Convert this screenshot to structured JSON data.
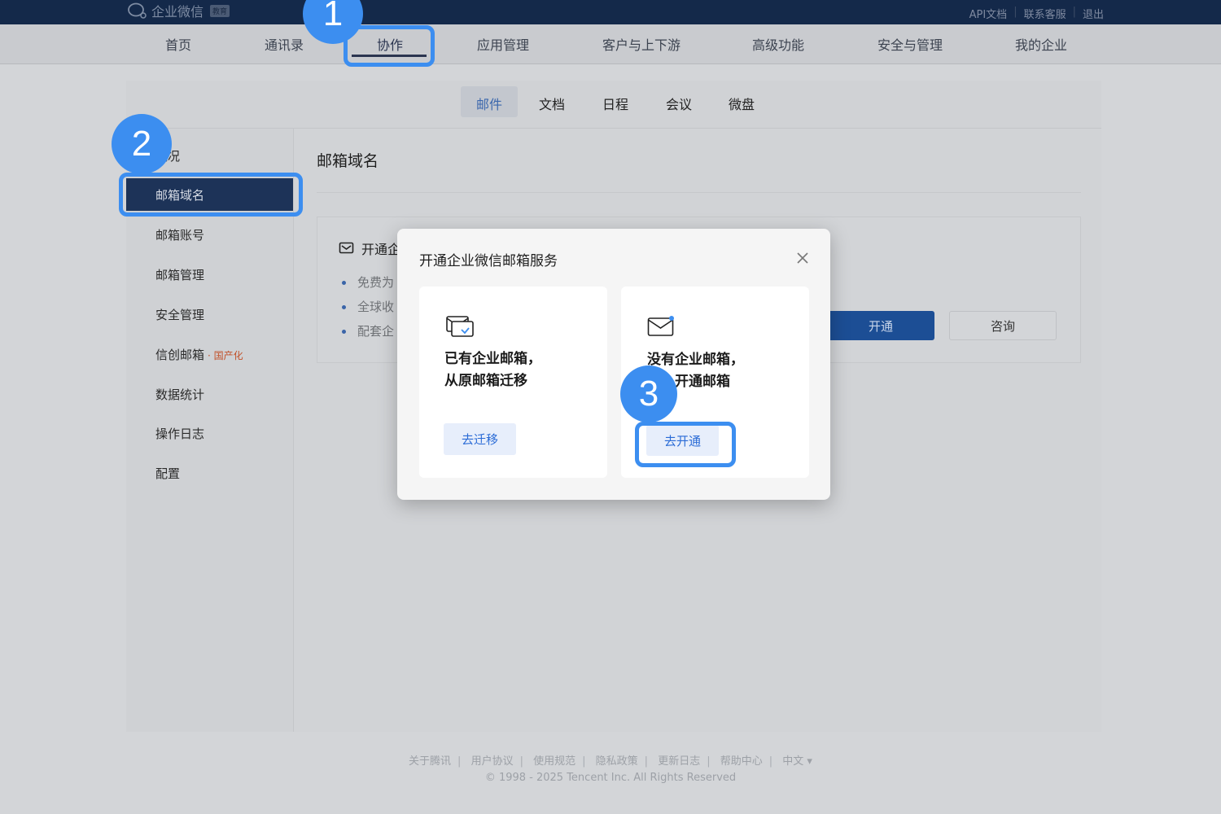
{
  "header": {
    "logo_text": "企业微信",
    "logo_badge": "教育",
    "links": [
      "API文档",
      "联系客服",
      "退出"
    ]
  },
  "nav": {
    "items": [
      "首页",
      "通讯录",
      "协作",
      "应用管理",
      "客户与上下游",
      "高级功能",
      "安全与管理",
      "我的企业"
    ],
    "active": "协作"
  },
  "subtabs": {
    "items": [
      "邮件",
      "文档",
      "日程",
      "会议",
      "微盘"
    ],
    "active": "邮件"
  },
  "sidebar": {
    "items": [
      "概况",
      "邮箱域名",
      "邮箱账号",
      "邮箱管理",
      "安全管理",
      "信创邮箱",
      "数据统计",
      "操作日志",
      "配置"
    ],
    "active": "邮箱域名",
    "xinchuang_tag": "· 国产化"
  },
  "main": {
    "title": "邮箱域名",
    "card_title": "开通企",
    "bullets": [
      "免费为",
      "全球收",
      "配套企"
    ],
    "open_button": "开通",
    "consult_button": "咨询"
  },
  "modal": {
    "title": "开通企业微信邮箱服务",
    "options": [
      {
        "line1": "已有企业邮箱，",
        "line2": "从原邮箱迁移",
        "button": "去迁移",
        "icon": "mail-migrate-icon"
      },
      {
        "line1": "没有企业邮箱，",
        "line2": "开通邮箱",
        "button": "去开通",
        "icon": "mail-new-icon"
      }
    ]
  },
  "callouts": [
    "1",
    "2",
    "3"
  ],
  "footer": {
    "links": [
      "关于腾讯",
      "用户协议",
      "使用规范",
      "隐私政策",
      "更新日志",
      "帮助中心",
      "中文 ▾"
    ],
    "copyright": "© 1998 - 2025 Tencent Inc. All Rights Reserved"
  },
  "colors": {
    "top_bar": "#14294a",
    "sidebar_active": "#1d3358",
    "primary_button": "#1c4e95",
    "callout": "#3c8ef0",
    "modal_button_text": "#2a6bd6"
  }
}
